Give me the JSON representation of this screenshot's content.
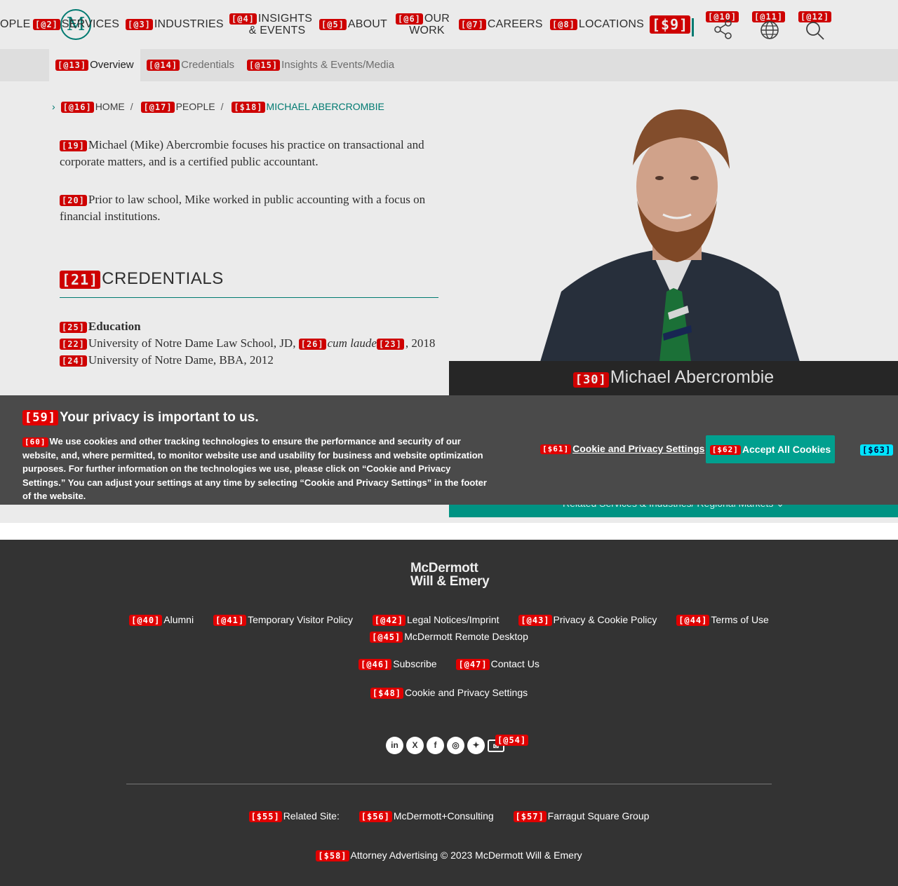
{
  "header": {
    "nav": [
      {
        "id": "people",
        "tag": "",
        "label": "OPLE"
      },
      {
        "id": "services",
        "tag": "[@2]",
        "label": "SERVICES"
      },
      {
        "id": "industries",
        "tag": "[@3]",
        "label": "INDUSTRIES"
      },
      {
        "id": "insights",
        "tag": "[@4]",
        "label1": "INSIGHTS",
        "label2": "& EVENTS"
      },
      {
        "id": "about",
        "tag": "[@5]",
        "label": "ABOUT"
      },
      {
        "id": "our-work",
        "tag": "[@6]",
        "label1": "OUR",
        "label2": "WORK"
      },
      {
        "id": "careers",
        "tag": "[@7]",
        "label": "CAREERS"
      },
      {
        "id": "locations",
        "tag": "[@8]",
        "label": "LOCATIONS"
      }
    ],
    "logo_letter": "M",
    "tags": {
      "t9": "[$9]",
      "t10": "[@10]",
      "t11": "[@11]",
      "t12": "[@12]"
    }
  },
  "subnav": {
    "items": [
      {
        "tag": "[@13]",
        "label": "Overview"
      },
      {
        "tag": "[@14]",
        "label": "Credentials"
      },
      {
        "tag": "[@15]",
        "label": "Insights & Events/Media"
      }
    ]
  },
  "breadcrumb": {
    "items": [
      {
        "tag": "[@16]",
        "label": "HOME"
      },
      {
        "tag": "[@17]",
        "label": "PEOPLE"
      },
      {
        "tag": "[$18]",
        "label": "MICHAEL ABERCROMBIE"
      }
    ],
    "separator": "/"
  },
  "bio": {
    "p1_tag": "[19]",
    "p1": "Michael (Mike) Abercrombie focuses his practice on transactional and corporate matters, and is a certified public accountant.",
    "p2_tag": "[20]",
    "p2": "Prior to law school, Mike worked in public accounting with a focus on financial institutions."
  },
  "credentials": {
    "tag": "[21]",
    "title": "CREDENTIALS",
    "education_tag": "[25]",
    "education_label": "Education",
    "line1_tag": "[22]",
    "line1_a": "University of Notre Dame Law School, JD,",
    "line1_honor_tag": "[26]",
    "line1_honor": "cum laude",
    "line1_year_tag": "[23]",
    "line1_b": ", 2018",
    "line2_tag": "[24]",
    "line2": "University of Notre Dame, BBA, 2012"
  },
  "profile": {
    "name_tag": "[30]",
    "name": "Michael Abercrombie",
    "related": "Related Services & Industries/ Regional Markets"
  },
  "cookie": {
    "title_tag": "[59]",
    "title": "Your privacy is important to us.",
    "body_tag": "[60]",
    "body": "We use cookies and other tracking technologies to ensure the performance and security of our website, and, where permitted, to monitor website use and usability for business and website optimization purposes. For further information on the technologies we use, please click on “Cookie and Privacy Settings.” You can adjust your settings at any time by selecting “Cookie and Privacy Settings” in the footer of the website.",
    "settings_tag": "[$61]",
    "settings_label": "Cookie and Privacy Settings",
    "accept_tag": "[$62]",
    "accept_label": "Accept All Cookies",
    "close_tag": "[$63]"
  },
  "footer": {
    "logo_line1": "McDermott",
    "logo_line2": "Will & Emery",
    "links_row1": [
      {
        "tag": "[@40]",
        "label": "Alumni"
      },
      {
        "tag": "[@41]",
        "label": "Temporary Visitor Policy"
      },
      {
        "tag": "[@42]",
        "label": "Legal Notices/Imprint"
      },
      {
        "tag": "[@43]",
        "label": "Privacy & Cookie Policy"
      },
      {
        "tag": "[@44]",
        "label": "Terms of Use"
      }
    ],
    "links_row2": [
      {
        "tag": "[@45]",
        "label": "McDermott Remote Desktop"
      }
    ],
    "links_row3": [
      {
        "tag": "[@46]",
        "label": "Subscribe"
      },
      {
        "tag": "[@47]",
        "label": "Contact Us"
      }
    ],
    "cookie_settings_tag": "[$48]",
    "cookie_settings": "Cookie and Privacy Settings",
    "social": [
      {
        "icon": "linkedin-icon",
        "glyph": "in"
      },
      {
        "icon": "xing-icon",
        "glyph": "X"
      },
      {
        "icon": "facebook-icon",
        "glyph": "f"
      },
      {
        "icon": "instagram-icon",
        "glyph": "◎"
      },
      {
        "icon": "twitter-icon",
        "glyph": "✦"
      },
      {
        "icon": "email-icon",
        "glyph": "✉"
      }
    ],
    "social_tag": "[@54]",
    "related_tag": "[$55]",
    "related_label": "Related Site:",
    "related_links": [
      {
        "tag": "[$56]",
        "label": "McDermott+Consulting"
      },
      {
        "tag": "[$57]",
        "label": "Farragut Square Group"
      }
    ],
    "copyright_tag": "[$58]",
    "copyright": "Attorney Advertising © 2023 McDermott Will & Emery"
  },
  "colors": {
    "brand": "#00857b",
    "accent_button": "#00a08f",
    "footer_bg": "#333333",
    "cookie_bg": "#4a4a4a",
    "tag_red": "#e00000"
  }
}
